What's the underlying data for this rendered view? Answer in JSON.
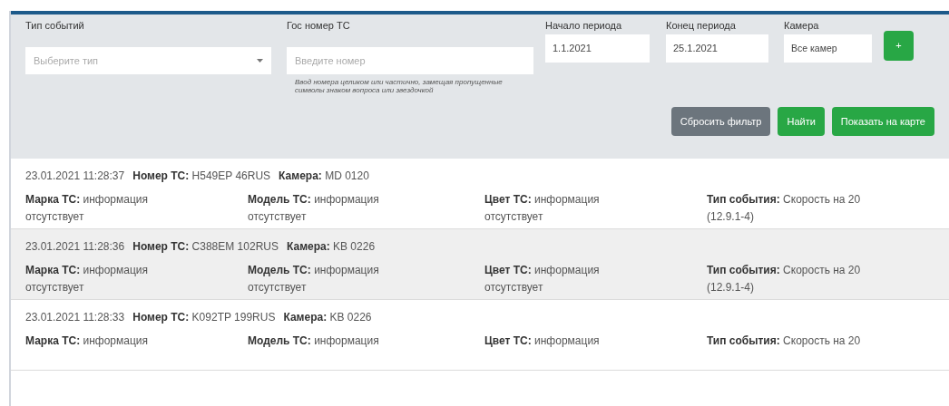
{
  "filters": {
    "event_type": {
      "label": "Тип событий",
      "placeholder": "Выберите тип"
    },
    "plate": {
      "label": "Гос номер ТС",
      "placeholder": "Введите номер",
      "hint": "Ввод номера целиком или частично, замещая пропущенные символы знаком вопроса или звездочкой"
    },
    "period_start": {
      "label": "Начало периода",
      "value": "1.1.2021"
    },
    "period_end": {
      "label": "Конец периода",
      "value": "25.1.2021"
    },
    "camera": {
      "label": "Камера",
      "value": "Все камер"
    },
    "add_button": "+",
    "buttons": [
      {
        "label": "Сбросить фильтр",
        "kind": "secondary"
      },
      {
        "label": "Найти",
        "kind": "primary"
      },
      {
        "label": "Показать на карте",
        "kind": "primary"
      }
    ]
  },
  "events": [
    {
      "selected": false,
      "time": "23.01.2021 11:28:37",
      "plate": "**Номер ТС:** H549EP 46RUS",
      "camera": "**Камера:** MD 0120",
      "fields": [
        "**Марка ТС:** информация отсутствует",
        "**Модель ТС:** информация отсутствует",
        "**Цвет ТС:** информация отсутствует",
        "**Тип события:** Скорость на 20 (12.9.1-4)"
      ]
    },
    {
      "selected": true,
      "time": "23.01.2021 11:28:36",
      "plate": "**Номер ТС:** C388EM 102RUS",
      "camera": "**Камера:** KB 0226",
      "fields": [
        "**Марка ТС:** информация отсутствует",
        "**Модель ТС:** информация отсутствует",
        "**Цвет ТС:** информация отсутствует",
        "**Тип события:** Скорость на 20 (12.9.1-4)"
      ]
    },
    {
      "selected": false,
      "time": "23.01.2021 11:28:33",
      "plate": "**Номер ТС:** K092TP 199RUS",
      "camera": "**Камера:** KB 0226",
      "fields": [
        "**Марка ТС:** информация",
        "**Модель ТС:** информация",
        "**Цвет ТС:** информация",
        "**Тип события:** Скорость на 20"
      ]
    }
  ]
}
